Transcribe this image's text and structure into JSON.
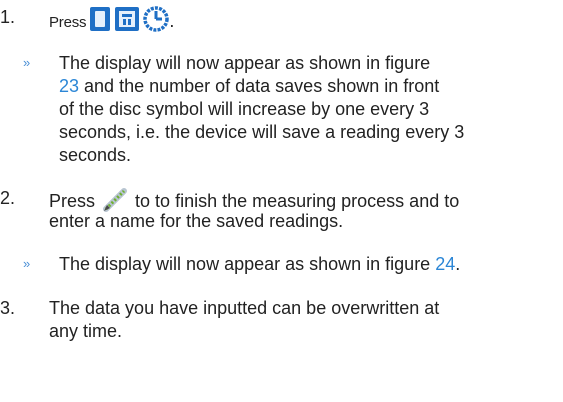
{
  "steps": [
    {
      "number": "1.",
      "text": "Press",
      "trailing": ".",
      "icons": [
        "phone-battery-icon",
        "save-disc-icon",
        "clock-timer-icon"
      ]
    },
    {
      "number": "2.",
      "before": "Press",
      "icon": "pen-icon",
      "after_line1": "to to finish the measuring process and to",
      "line2": "enter a name for the saved readings."
    },
    {
      "number": "3.",
      "line1": "The data you have inputted can be overwritten at",
      "line2": "any time."
    }
  ],
  "results": [
    {
      "marker": "»",
      "line1": "The display will now appear as shown in figure",
      "figure_ref": "23",
      "line2_rest": " and the number of data saves shown in front",
      "line3": "of the disc symbol will increase by one every 3",
      "line4": "seconds, i.e. the device will save a reading every 3",
      "line5": "seconds."
    },
    {
      "marker": "»",
      "before": "The display will now appear as shown in figure ",
      "figure_ref": "24",
      "after": "."
    }
  ],
  "colors": {
    "link": "#2b86d6",
    "icon_blue": "#1f6fc5",
    "marker": "#4a8fd6"
  }
}
